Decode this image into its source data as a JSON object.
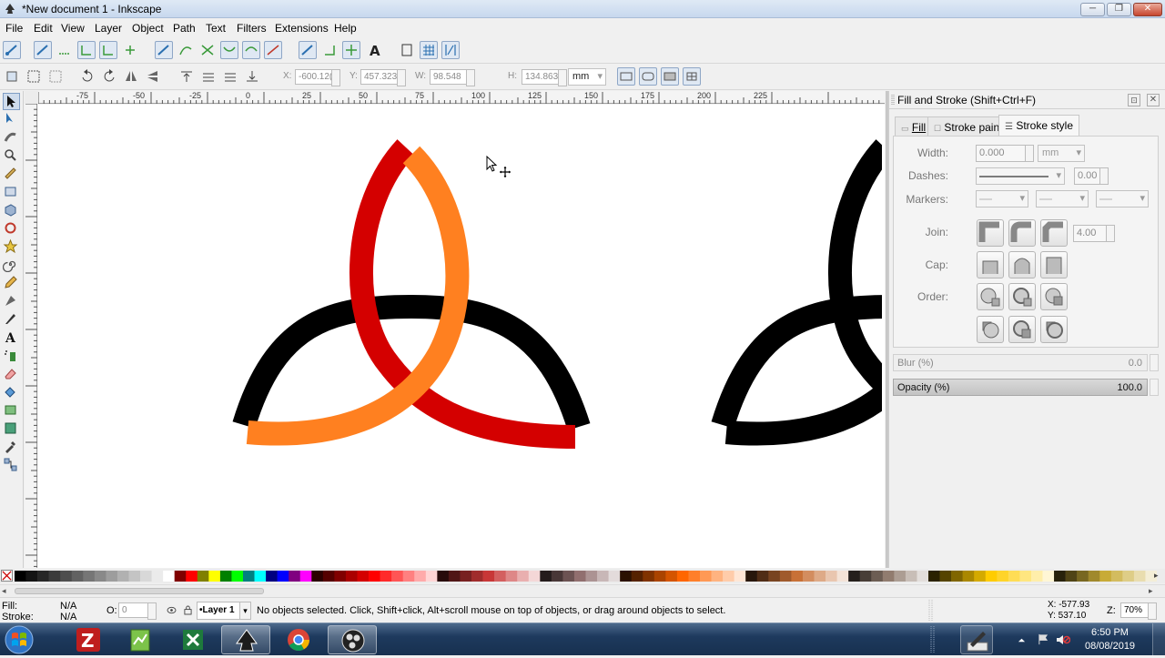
{
  "window": {
    "title": "*New document 1 - Inkscape"
  },
  "menu": [
    "File",
    "Edit",
    "View",
    "Layer",
    "Object",
    "Path",
    "Text",
    "Filters",
    "Extensions",
    "Help"
  ],
  "selector_toolbar": {
    "x_label": "X:",
    "x_value": "-600.12(",
    "y_label": "Y:",
    "y_value": "457.323",
    "w_label": "W:",
    "w_value": "98.548",
    "h_label": "H:",
    "h_value": "134.863",
    "unit": "mm"
  },
  "ruler_labels": [
    "-75",
    "-50",
    "-25",
    "0",
    "25",
    "50",
    "75",
    "100",
    "125",
    "150",
    "175",
    "200",
    "225"
  ],
  "dock": {
    "title": "Fill and Stroke (Shift+Ctrl+F)",
    "tabs": [
      "Fill",
      "Stroke paint",
      "Stroke style"
    ],
    "active_tab": "Stroke style",
    "stroke_style": {
      "width_label": "Width:",
      "width_value": "0.000",
      "width_unit": "mm",
      "dashes_label": "Dashes:",
      "dashes_value": "0.00",
      "markers_label": "Markers:",
      "join_label": "Join:",
      "miter_value": "4.00",
      "cap_label": "Cap:",
      "order_label": "Order:"
    },
    "blur_label": "Blur (%)",
    "blur_value": "0.0",
    "opacity_label": "Opacity (%)",
    "opacity_value": "100.0"
  },
  "statusbar": {
    "fill_label": "Fill:",
    "fill_value": "N/A",
    "stroke_label": "Stroke:",
    "stroke_value": "N/A",
    "opacity_label": "O:",
    "opacity_value": "0",
    "layer": "•Layer 1",
    "message": "No objects selected. Click, Shift+click, Alt+scroll mouse on top of objects, or drag around objects to select.",
    "cursor_x": "X: -577.93",
    "cursor_y": "Y:  537.10",
    "zoom_label": "Z:",
    "zoom_value": "70%"
  },
  "taskbar": {
    "time": "6:50 PM",
    "date": "08/08/2019"
  },
  "colors": {
    "red_arc": "#d40000",
    "orange_arc": "#ff8020",
    "black_arc": "#000000",
    "accent": "#3a6ea5"
  }
}
